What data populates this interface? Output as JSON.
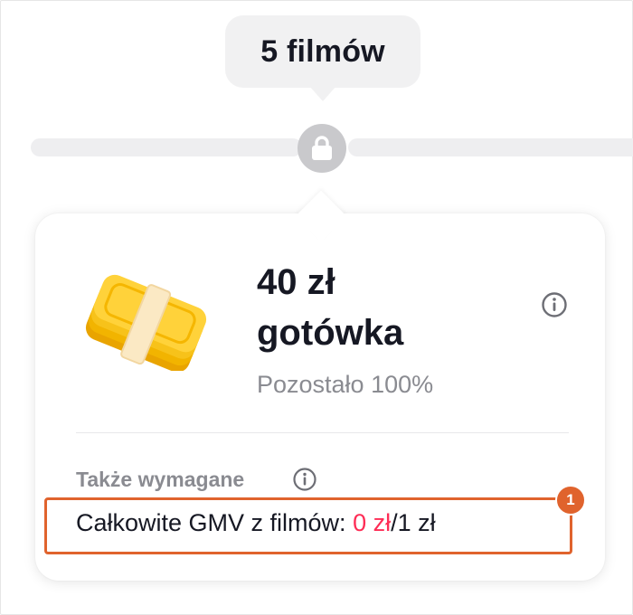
{
  "milestone": {
    "label": "5 filmów",
    "locked": true
  },
  "reward": {
    "amount": "40 zł",
    "type": "gotówka",
    "remaining": "Pozostało 100%",
    "icon": "cash-stack-icon"
  },
  "requirements": {
    "heading": "Także wymagane",
    "gmv_label": "Całkowite GMV z filmów: ",
    "gmv_current": "0 zł",
    "gmv_separator": "/",
    "gmv_target": "1 zł",
    "badge": "1"
  },
  "colors": {
    "highlight": "#e0632d",
    "current_value": "#fe2c55",
    "track": "#eeeef0",
    "lock": "#c9c9cc"
  }
}
